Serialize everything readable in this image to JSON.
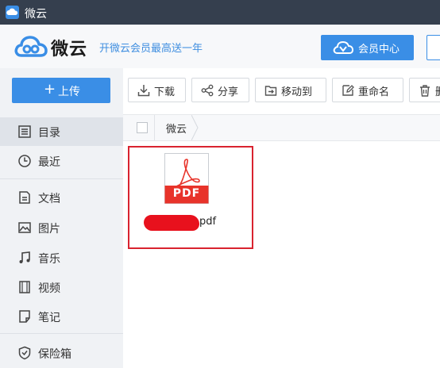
{
  "window": {
    "title": "微云"
  },
  "header": {
    "logo_text": "微云",
    "promo_text": "开微云会员最高送一年",
    "vip_button": "会员中心"
  },
  "sidebar": {
    "upload_label": "上传",
    "items": [
      {
        "label": "目录",
        "icon": "list-icon",
        "active": true
      },
      {
        "label": "最近",
        "icon": "clock-icon"
      },
      {
        "label": "文档",
        "icon": "document-icon"
      },
      {
        "label": "图片",
        "icon": "image-icon"
      },
      {
        "label": "音乐",
        "icon": "music-icon"
      },
      {
        "label": "视频",
        "icon": "video-icon"
      },
      {
        "label": "笔记",
        "icon": "note-icon"
      },
      {
        "label": "保险箱",
        "icon": "shield-icon"
      }
    ]
  },
  "toolbar": {
    "download": "下载",
    "share": "分享",
    "move_to": "移动到",
    "rename": "重命名",
    "delete": "删"
  },
  "breadcrumb": {
    "root": "微云"
  },
  "files": [
    {
      "badge": "PDF",
      "name_suffix": "pdf",
      "selected": true
    }
  ],
  "colors": {
    "accent": "#3a8ee6",
    "titlebar": "#353f4e",
    "pdf_red": "#e8332a",
    "highlight_border": "#d9232f"
  }
}
